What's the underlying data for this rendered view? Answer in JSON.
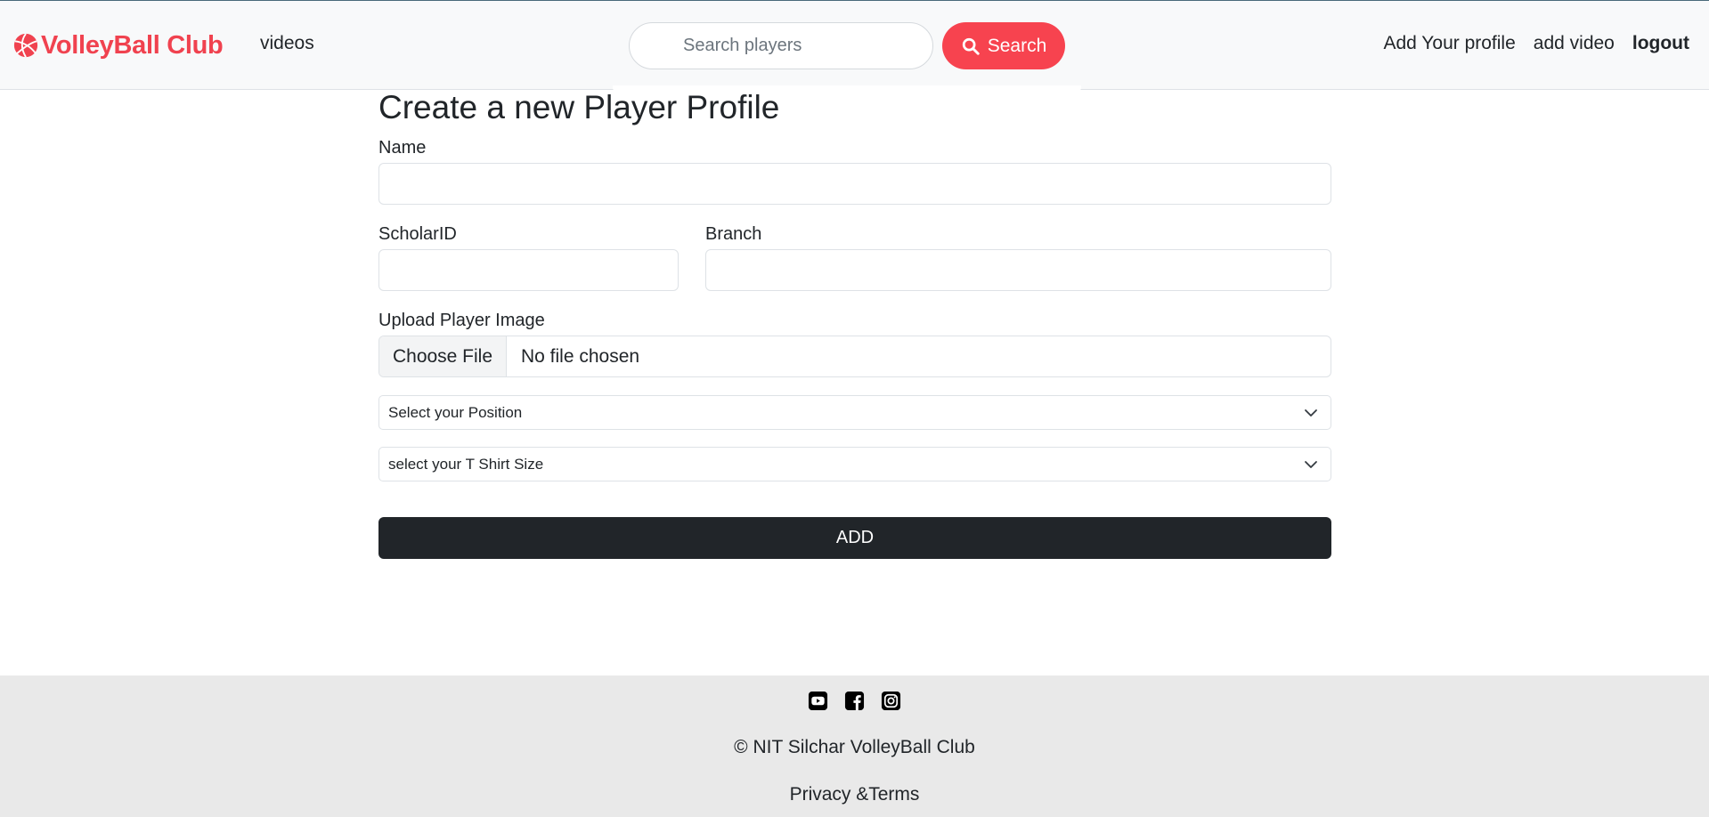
{
  "navbar": {
    "brand": "VolleyBall Club",
    "brand_color": "#f0424f",
    "brand_icon": "volleyball-icon",
    "videos_link": "videos",
    "search": {
      "placeholder": "Search players",
      "button_label": "Search",
      "button_icon": "search-icon",
      "button_color": "#f7434f"
    },
    "right_links": {
      "add_profile": "Add Your profile",
      "add_video": "add video",
      "logout": "logout"
    }
  },
  "form": {
    "title": "Create a new Player Profile",
    "name_label": "Name",
    "name_value": "",
    "scholar_id_label": "ScholarID",
    "scholar_id_value": "",
    "branch_label": "Branch",
    "branch_value": "",
    "upload_label": "Upload Player Image",
    "file_button": "Choose File",
    "file_status": "No file chosen",
    "position_select": "Select your Position",
    "tshirt_select": "select your T Shirt Size",
    "submit_label": "ADD",
    "submit_color": "#212529"
  },
  "footer": {
    "social_icons": [
      "youtube-icon",
      "facebook-icon",
      "instagram-icon"
    ],
    "copyright": "© NIT Silchar VolleyBall Club",
    "privacy": "Privacy &Terms",
    "background": "#e9e9e9"
  }
}
